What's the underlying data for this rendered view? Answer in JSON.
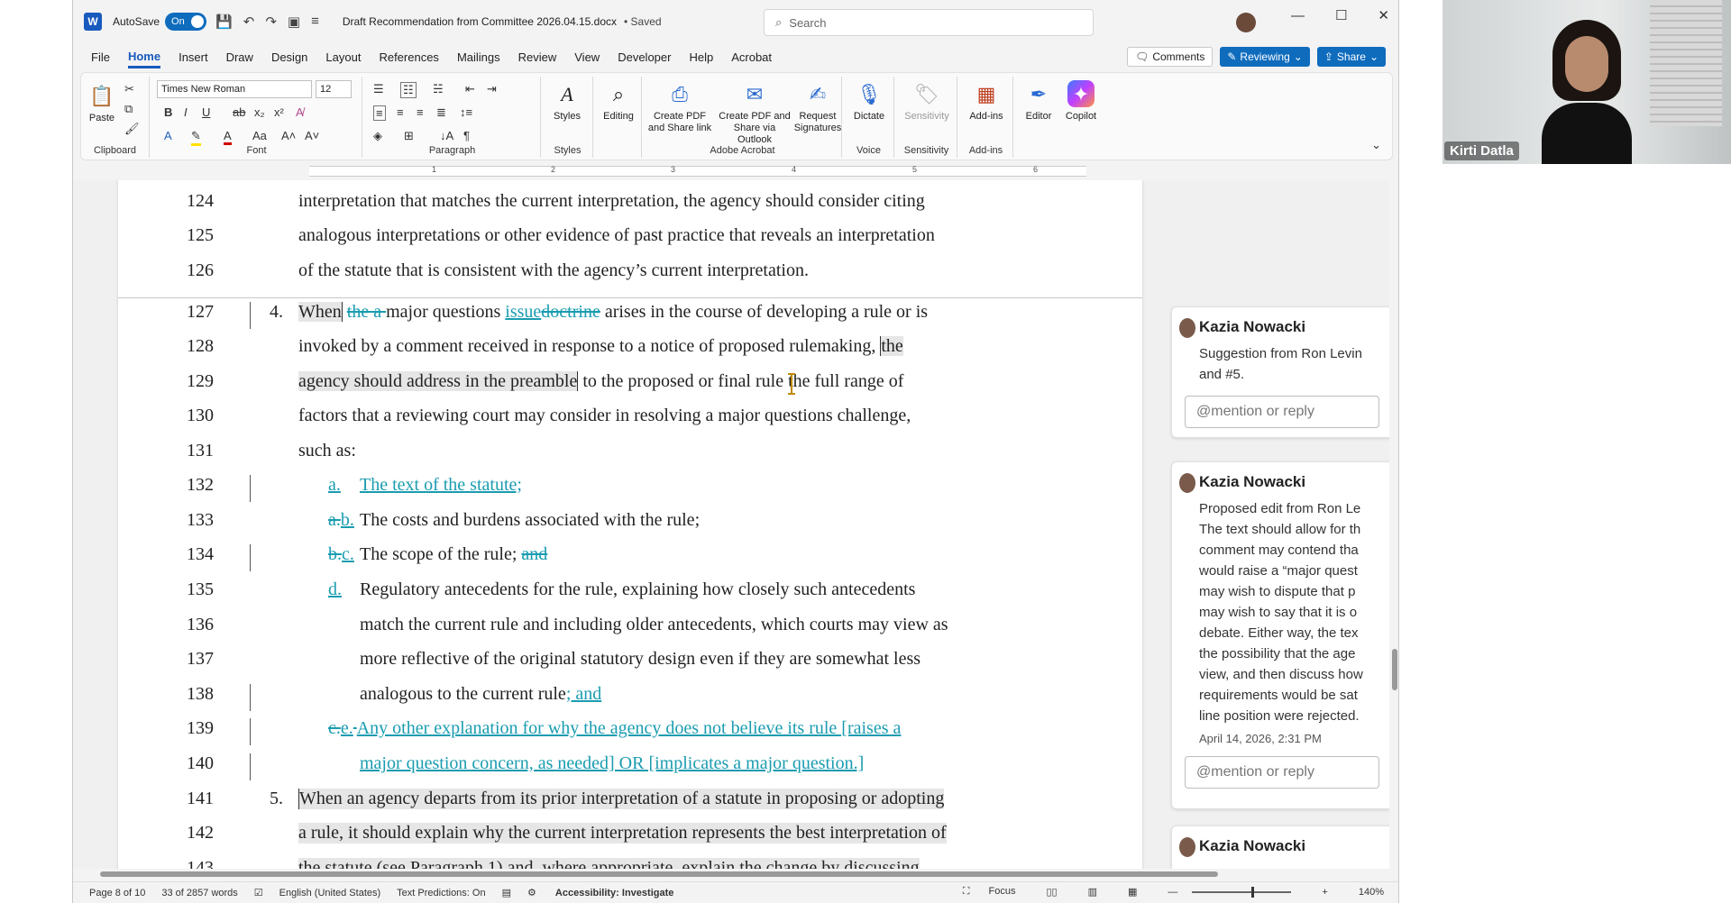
{
  "titlebar": {
    "autosave_label": "AutoSave",
    "autosave_state": "On",
    "doc_title": "Draft Recommendation from Committee 2026.04.15.docx",
    "saved": "• Saved",
    "search_placeholder": "Search"
  },
  "menu": {
    "tabs": [
      "File",
      "Home",
      "Insert",
      "Draw",
      "Design",
      "Layout",
      "References",
      "Mailings",
      "Review",
      "View",
      "Developer",
      "Help",
      "Acrobat"
    ],
    "active": "Home",
    "comments_label": "Comments",
    "reviewing_label": "Reviewing",
    "share_label": "Share"
  },
  "ribbon": {
    "paste": "Paste",
    "clipboard": "Clipboard",
    "font_name": "Times New Roman",
    "font_size": "12",
    "font": "Font",
    "paragraph": "Paragraph",
    "styles_btn": "Styles",
    "styles": "Styles",
    "editing": "Editing",
    "create_pdf": "Create PDF and Share link",
    "create_pdf_outlook": "Create PDF and Share via Outlook",
    "request_signatures": "Request Signatures",
    "adobe_acrobat": "Adobe Acrobat",
    "dictate": "Dictate",
    "voice": "Voice",
    "sensitivity_btn": "Sensitivity",
    "sensitivity": "Sensitivity",
    "addins_btn": "Add-ins",
    "addins": "Add-ins",
    "editor": "Editor",
    "copilot": "Copilot"
  },
  "ruler": {
    "numbers": [
      "1",
      "2",
      "3",
      "4",
      "5",
      "6"
    ]
  },
  "document": {
    "lines": [
      {
        "n": "124",
        "t": "interpretation that matches the current interpretation, the agency should consider citing"
      },
      {
        "n": "125",
        "t": "analogous interpretations or other evidence of past practice that reveals an interpretation"
      },
      {
        "n": "126",
        "t": "of the statute that is consistent with the agency’s current interpretation."
      },
      {
        "n": "127",
        "num": "4.",
        "a": "When",
        "del1": "the a ",
        "b": "major questions ",
        "ins1": "issue",
        "del2": "doctrine",
        "c": " arises in the course of developing a rule or is"
      },
      {
        "n": "128",
        "a": "invoked by a comment received in response to a notice of proposed rulemaking, ",
        "hl": "the"
      },
      {
        "n": "129",
        "hl": "agency should address in the preamble",
        "a": " to the proposed or final rule the full range of"
      },
      {
        "n": "130",
        "t": "factors that a reviewing court may consider in resolving a major questions challenge,"
      },
      {
        "n": "131",
        "t": "such as:"
      },
      {
        "n": "132",
        "ins_marker": "a.",
        "ins_text": "The text of the statute;"
      },
      {
        "n": "133",
        "del_marker": "a.",
        "ins_marker": "b.",
        "t": "The costs and burdens associated with the rule;"
      },
      {
        "n": "134",
        "del_marker": "b.",
        "ins_marker": "c.",
        "t": "The scope of the rule; ",
        "del_text": "and"
      },
      {
        "n": "135",
        "ins_marker": "d.",
        "t": "Regulatory antecedents for the rule, explaining how closely such antecedents"
      },
      {
        "n": "136",
        "t": "match the current rule and including older antecedents, which courts may view as"
      },
      {
        "n": "137",
        "t": "more reflective of the original statutory design even if they are somewhat less"
      },
      {
        "n": "138",
        "t": "analogous to the current rule",
        "ins_text": "; and"
      },
      {
        "n": "139",
        "del_marker": "c.",
        "ins_marker": "e.",
        "del_extra": " ",
        "ins_text": "Any other explanation for why the agency does not believe its rule [raises a"
      },
      {
        "n": "140",
        "ins_text": "major question concern, as needed] OR [implicates a major question.]"
      },
      {
        "n": "141",
        "num": "5.",
        "hl": "When an agency departs from its prior interpretation of a statute in proposing or adopting"
      },
      {
        "n": "142",
        "hl": "a rule, it should explain why the current interpretation represents the best interpretation of"
      },
      {
        "n": "143",
        "hl": "the statute (see Paragraph 1) and, where appropriate, explain the change by discussing"
      }
    ]
  },
  "comments": [
    {
      "author": "Kazia Nowacki",
      "body": [
        "Suggestion from Ron Levin",
        "and #5."
      ],
      "reply_placeholder": "@mention or reply"
    },
    {
      "author": "Kazia Nowacki",
      "body": [
        "Proposed edit from Ron Le",
        "The text should allow for th",
        "comment may contend tha",
        "would raise a “major quest",
        "may wish to dispute that p",
        "may wish to say that it is o",
        "debate.  Either way, the tex",
        "the possibility that the age",
        "view, and then discuss how",
        "requirements would be sat",
        "line position were rejected."
      ],
      "timestamp": "April 14, 2026, 2:31 PM",
      "reply_placeholder": "@mention or reply"
    },
    {
      "author": "Kazia Nowacki",
      "body": []
    }
  ],
  "status": {
    "page": "Page 8 of 10",
    "words": "33 of 2857 words",
    "language": "English (United States)",
    "predictions": "Text Predictions: On",
    "accessibility": "Accessibility: Investigate",
    "focus": "Focus",
    "zoom": "140%"
  },
  "video": {
    "name": "Kirti Datla"
  },
  "colors": {
    "accent": "#185abd",
    "track_changes": "#1a9cb0",
    "highlight": "#e6e6e6"
  }
}
